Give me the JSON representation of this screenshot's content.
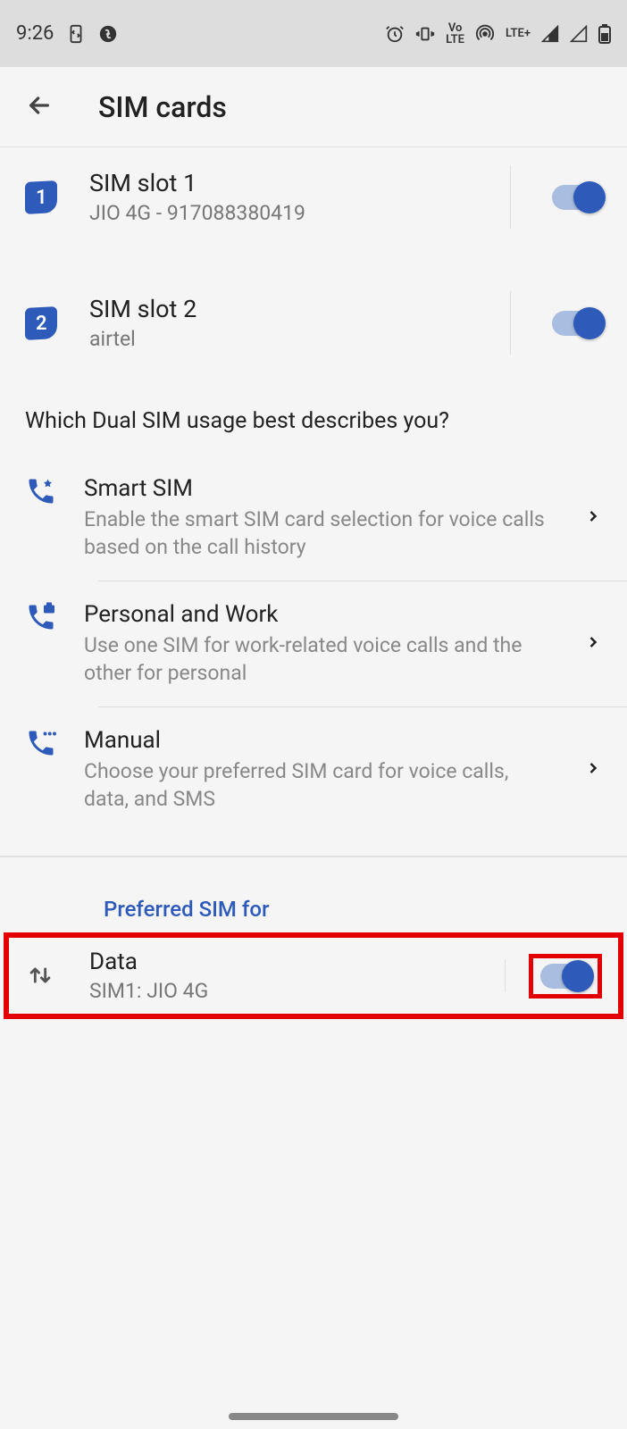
{
  "status": {
    "time": "9:26",
    "volte": "Vo\nLTE",
    "lte": "LTE+"
  },
  "header": {
    "title": "SIM cards"
  },
  "sims": [
    {
      "badge": "1",
      "title": "SIM slot 1",
      "sub": "JIO 4G - 917088380419"
    },
    {
      "badge": "2",
      "title": "SIM slot 2",
      "sub": "airtel"
    }
  ],
  "question": "Which Dual SIM usage best describes you?",
  "usages": [
    {
      "title": "Smart SIM",
      "sub": "Enable the smart SIM card selection for voice calls based on the call history"
    },
    {
      "title": "Personal and Work",
      "sub": "Use one SIM for work-related voice calls and the other for personal"
    },
    {
      "title": "Manual",
      "sub": "Choose your preferred SIM card for voice calls, data, and SMS"
    }
  ],
  "preferred": {
    "header": "Preferred SIM for",
    "data_title": "Data",
    "data_sub": "SIM1: JIO 4G"
  }
}
